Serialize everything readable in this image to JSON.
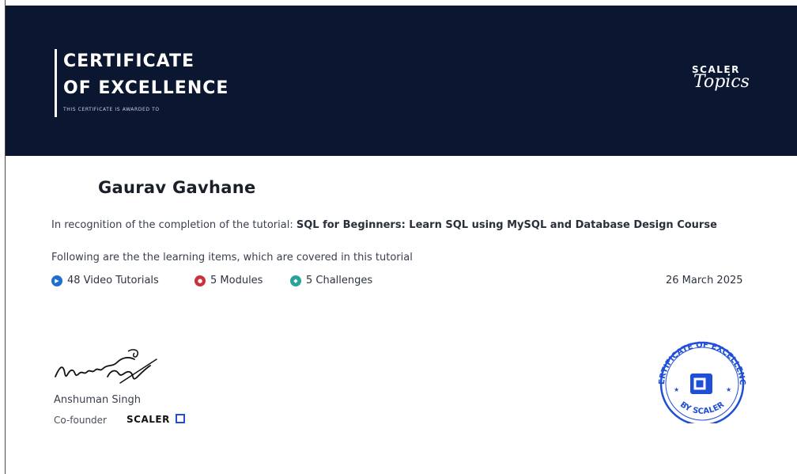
{
  "header": {
    "title_line1": "CERTIFICATE",
    "title_line2": "OF EXCELLENCE",
    "subtitle": "THIS CERTIFICATE IS AWARDED TO",
    "logo_top": "SCALER",
    "logo_bottom": "Topics"
  },
  "recipient": {
    "name": "Gaurav Gavhane"
  },
  "body": {
    "recognition_prefix": "In recognition of the completion of the tutorial: ",
    "tutorial_name": "SQL for Beginners: Learn SQL using MySQL and Database Design Course",
    "following": "Following are the the learning items, which are covered in this tutorial"
  },
  "stats": [
    {
      "label": "48 Video Tutorials",
      "icon": "play-icon",
      "color": "#1f6fd1"
    },
    {
      "label": "5 Modules",
      "icon": "module-icon",
      "color": "#c8323c"
    },
    {
      "label": "5 Challenges",
      "icon": "challenge-icon",
      "color": "#2aa39a"
    }
  ],
  "date": "26 March 2025",
  "signer": {
    "name": "Anshuman Singh",
    "role": "Co-founder",
    "brand": "SCALER"
  },
  "seal": {
    "top_text": "CERTIFICATE OF EXCELLENCE",
    "bottom_text": "BY SCALER",
    "color": "#1f4fd6"
  },
  "colors": {
    "header_bg": "#0b1730"
  }
}
